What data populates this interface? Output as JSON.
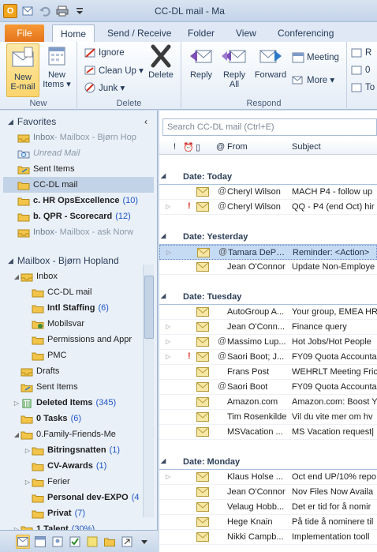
{
  "window": {
    "title": "CC-DL mail - Ma"
  },
  "tabs": [
    {
      "label": "File"
    },
    {
      "label": "Home"
    },
    {
      "label": "Send / Receive"
    },
    {
      "label": "Folder"
    },
    {
      "label": "View"
    },
    {
      "label": "Conferencing"
    }
  ],
  "ribbon": {
    "new_group": "New",
    "new_email": "New\nE-mail",
    "new_email_l1": "New",
    "new_email_l2": "E-mail",
    "new_items_l1": "New",
    "new_items_l2": "Items ▾",
    "delete_group": "Delete",
    "ignore": "Ignore",
    "cleanup": "Clean Up ▾",
    "junk": "Junk ▾",
    "delete": "Delete",
    "respond_group": "Respond",
    "reply": "Reply",
    "reply_all_l1": "Reply",
    "reply_all_l2": "All",
    "forward": "Forward",
    "meeting": "Meeting",
    "more": "More ▾",
    "cut1": "R",
    "cut2": "0",
    "cut3": "To"
  },
  "nav": {
    "favorites_header": "Favorites",
    "favorites": [
      {
        "name": "Inbox",
        "suffix": " - Mailbox - Bjørn Hop",
        "style": "grey"
      },
      {
        "name": "Unread Mail",
        "style": "italic"
      },
      {
        "name": "Sent Items",
        "style": "normal"
      },
      {
        "name": "CC-DL mail",
        "style": "normal",
        "selected": true
      },
      {
        "name": "c. HR OpsExcellence",
        "count": "(10)",
        "style": "bold"
      },
      {
        "name": "b. QPR - Scorecard",
        "count": "(12)",
        "style": "bold"
      },
      {
        "name": "Inbox",
        "suffix": " - Mailbox - ask Norw",
        "style": "grey"
      }
    ],
    "mailbox_header": "Mailbox - Bjørn Hopland",
    "folders": [
      {
        "name": "Inbox",
        "level": 1,
        "exp": "◢"
      },
      {
        "name": "CC-DL mail",
        "level": 2
      },
      {
        "name": "Intl Staffing",
        "count": "(6)",
        "level": 2,
        "bold": true
      },
      {
        "name": "Mobilsvar",
        "level": 2
      },
      {
        "name": "Permissions and Appr",
        "level": 2
      },
      {
        "name": "PMC",
        "level": 2
      },
      {
        "name": "Drafts",
        "level": 1
      },
      {
        "name": "Sent Items",
        "level": 1
      },
      {
        "name": "Deleted Items",
        "count": "(345)",
        "level": 1,
        "bold": true,
        "exp": "▷"
      },
      {
        "name": "0 Tasks",
        "count": "(6)",
        "level": 1,
        "bold": true
      },
      {
        "name": "0.Family-Friends-Me",
        "level": 1,
        "exp": "◢"
      },
      {
        "name": "Bitringsnatten",
        "count": "(1)",
        "level": 2,
        "bold": true,
        "exp": "▷"
      },
      {
        "name": "CV-Awards",
        "count": "(1)",
        "level": 2,
        "bold": true
      },
      {
        "name": "Ferier",
        "level": 2,
        "exp": "▷"
      },
      {
        "name": "Personal dev-EXPO",
        "count": "(4",
        "level": 2,
        "bold": true
      },
      {
        "name": "Privat",
        "count": "(7)",
        "level": 2,
        "bold": true
      },
      {
        "name": "1.Talent",
        "count": "(30%)",
        "level": 1,
        "bold": true,
        "exp": "▷"
      }
    ]
  },
  "list": {
    "search_placeholder": "Search CC-DL mail (Ctrl+E)",
    "col_from": "From",
    "col_subject": "Subject",
    "groups": [
      {
        "label": "Date: Today",
        "rows": [
          {
            "from": "Cheryl Wilson",
            "subject": "MACH P4 - follow up",
            "clip": true,
            "exp": false,
            "imp": false
          },
          {
            "from": "Cheryl Wilson",
            "subject": "QQ - P4 (end Oct) hir",
            "clip": true,
            "exp": true,
            "imp": true
          }
        ]
      },
      {
        "label": "Date: Yesterday",
        "rows": [
          {
            "from": "Tamara DePo...",
            "subject": "Reminder: <Action>",
            "clip": true,
            "exp": true,
            "imp": false,
            "selected": true
          },
          {
            "from": "Jean O'Connor",
            "subject": "Update Non-Employe",
            "clip": false,
            "exp": false,
            "imp": false
          }
        ]
      },
      {
        "label": "Date: Tuesday",
        "rows": [
          {
            "from": "AutoGroup A...",
            "subject": "Your group, EMEA HR",
            "clip": false,
            "exp": false,
            "imp": false
          },
          {
            "from": "Jean O'Conn...",
            "subject": "Finance query",
            "clip": false,
            "exp": true,
            "imp": false
          },
          {
            "from": "Massimo Lup...",
            "subject": "Hot Jobs/Hot People",
            "clip": true,
            "exp": true,
            "imp": false
          },
          {
            "from": "Saori Boot; J...",
            "subject": "FY09 Quota Accounta",
            "clip": true,
            "exp": true,
            "imp": true
          },
          {
            "from": "Frans Post",
            "subject": "WEHRLT Meeting Fric",
            "clip": false,
            "exp": false,
            "imp": false
          },
          {
            "from": "Saori Boot",
            "subject": "FY09 Quota Accounta",
            "clip": true,
            "exp": false,
            "imp": false
          },
          {
            "from": "Amazon.com",
            "subject": "Amazon.com: Boost Y",
            "clip": false,
            "exp": false,
            "imp": false
          },
          {
            "from": "Tim Rosenkilde",
            "subject": "Vil du vite mer om hv",
            "clip": false,
            "exp": false,
            "imp": false
          },
          {
            "from": "MSVacation ...",
            "subject": "MS Vacation request|",
            "clip": false,
            "exp": false,
            "imp": false
          }
        ]
      },
      {
        "label": "Date: Monday",
        "rows": [
          {
            "from": "Klaus Holse ...",
            "subject": "Oct end UP/10% repo",
            "clip": false,
            "exp": true,
            "imp": false
          },
          {
            "from": "Jean O'Connor",
            "subject": "Nov Files Now Availa",
            "clip": false,
            "exp": false,
            "imp": false
          },
          {
            "from": "Velaug Hobb...",
            "subject": "Det er tid for å nomir",
            "clip": false,
            "exp": false,
            "imp": false
          },
          {
            "from": "Hege Knain",
            "subject": "På tide å nominere til",
            "clip": false,
            "exp": false,
            "imp": false
          },
          {
            "from": "Nikki Campb...",
            "subject": "Implementation tooll",
            "clip": false,
            "exp": false,
            "imp": false
          }
        ]
      }
    ]
  }
}
